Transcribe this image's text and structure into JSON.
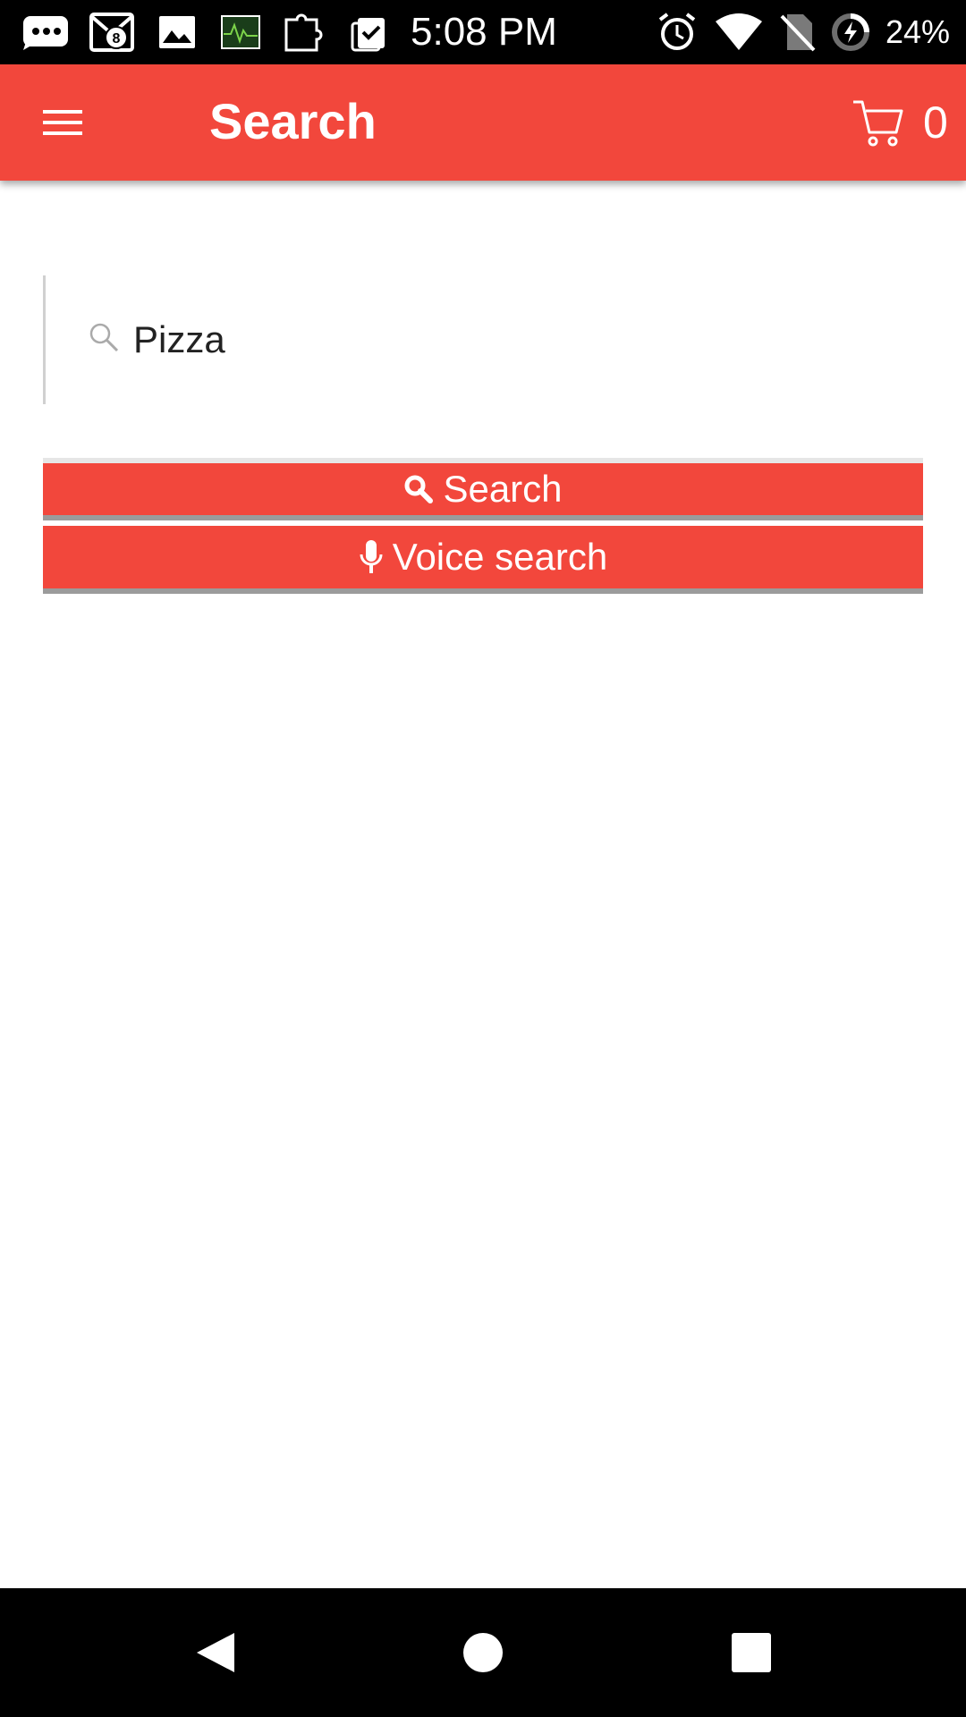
{
  "status_bar": {
    "time": "5:08 PM",
    "battery_percent": "24%",
    "notification_badge": "8",
    "icons": [
      "chat-bubble-icon",
      "mail-icon",
      "image-icon",
      "activity-monitor-icon",
      "puzzle-icon",
      "clipboard-check-icon",
      "alarm-icon",
      "wifi-icon",
      "no-sim-icon",
      "battery-charging-icon"
    ]
  },
  "app_bar": {
    "title": "Search",
    "cart_count": "0",
    "menu_icon": "hamburger-menu-icon",
    "cart_icon": "shopping-cart-icon"
  },
  "search": {
    "value": "Pizza",
    "icon": "search-icon"
  },
  "buttons": {
    "search_label": "Search",
    "voice_label": "Voice search"
  },
  "colors": {
    "brand": "#f2473c",
    "status_bar": "#000000",
    "nav_bar": "#000000"
  },
  "nav_bar": {
    "icons": [
      "back-icon",
      "home-icon",
      "recents-icon"
    ]
  }
}
